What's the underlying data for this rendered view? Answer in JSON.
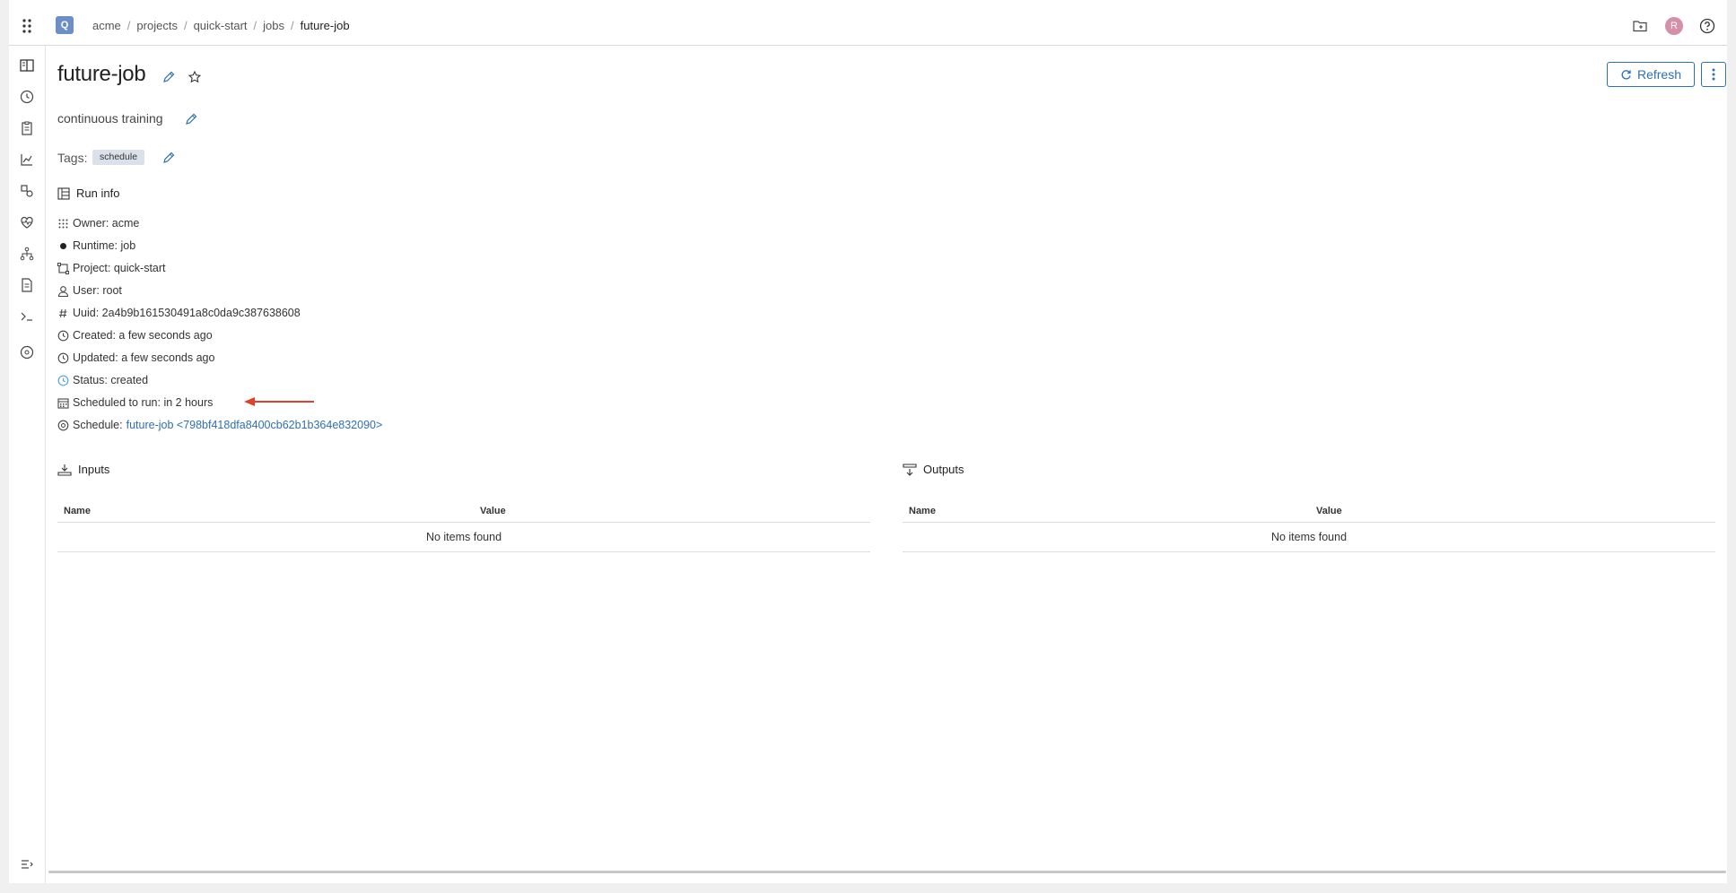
{
  "app": {
    "logo_letter": "Q",
    "avatar_letter": "R"
  },
  "breadcrumbs": [
    "acme",
    "projects",
    "quick-start",
    "jobs",
    "future-job"
  ],
  "header": {
    "title": "future-job",
    "description": "continuous training",
    "tags_label": "Tags:",
    "tags": [
      "schedule"
    ],
    "refresh_label": "Refresh"
  },
  "run_info": {
    "title": "Run info",
    "owner": "Owner: acme",
    "runtime": "Runtime: job",
    "project": "Project: quick-start",
    "user": "User: root",
    "uuid": "Uuid: 2a4b9b161530491a8c0da9c387638608",
    "created": "Created: a few seconds ago",
    "updated": "Updated: a few seconds ago",
    "status": "Status: created",
    "scheduled": "Scheduled to run: in 2 hours",
    "schedule_label": "Schedule:",
    "schedule_link": "future-job <798bf418dfa8400cb62b1b364e832090>"
  },
  "inputs": {
    "title": "Inputs",
    "col_name": "Name",
    "col_value": "Value",
    "empty": "No items found"
  },
  "outputs": {
    "title": "Outputs",
    "col_name": "Name",
    "col_value": "Value",
    "empty": "No items found"
  },
  "colors": {
    "accent": "#2f6fb3",
    "annotation_arrow": "#e0402a",
    "status_icon": "#5aa3e0"
  }
}
